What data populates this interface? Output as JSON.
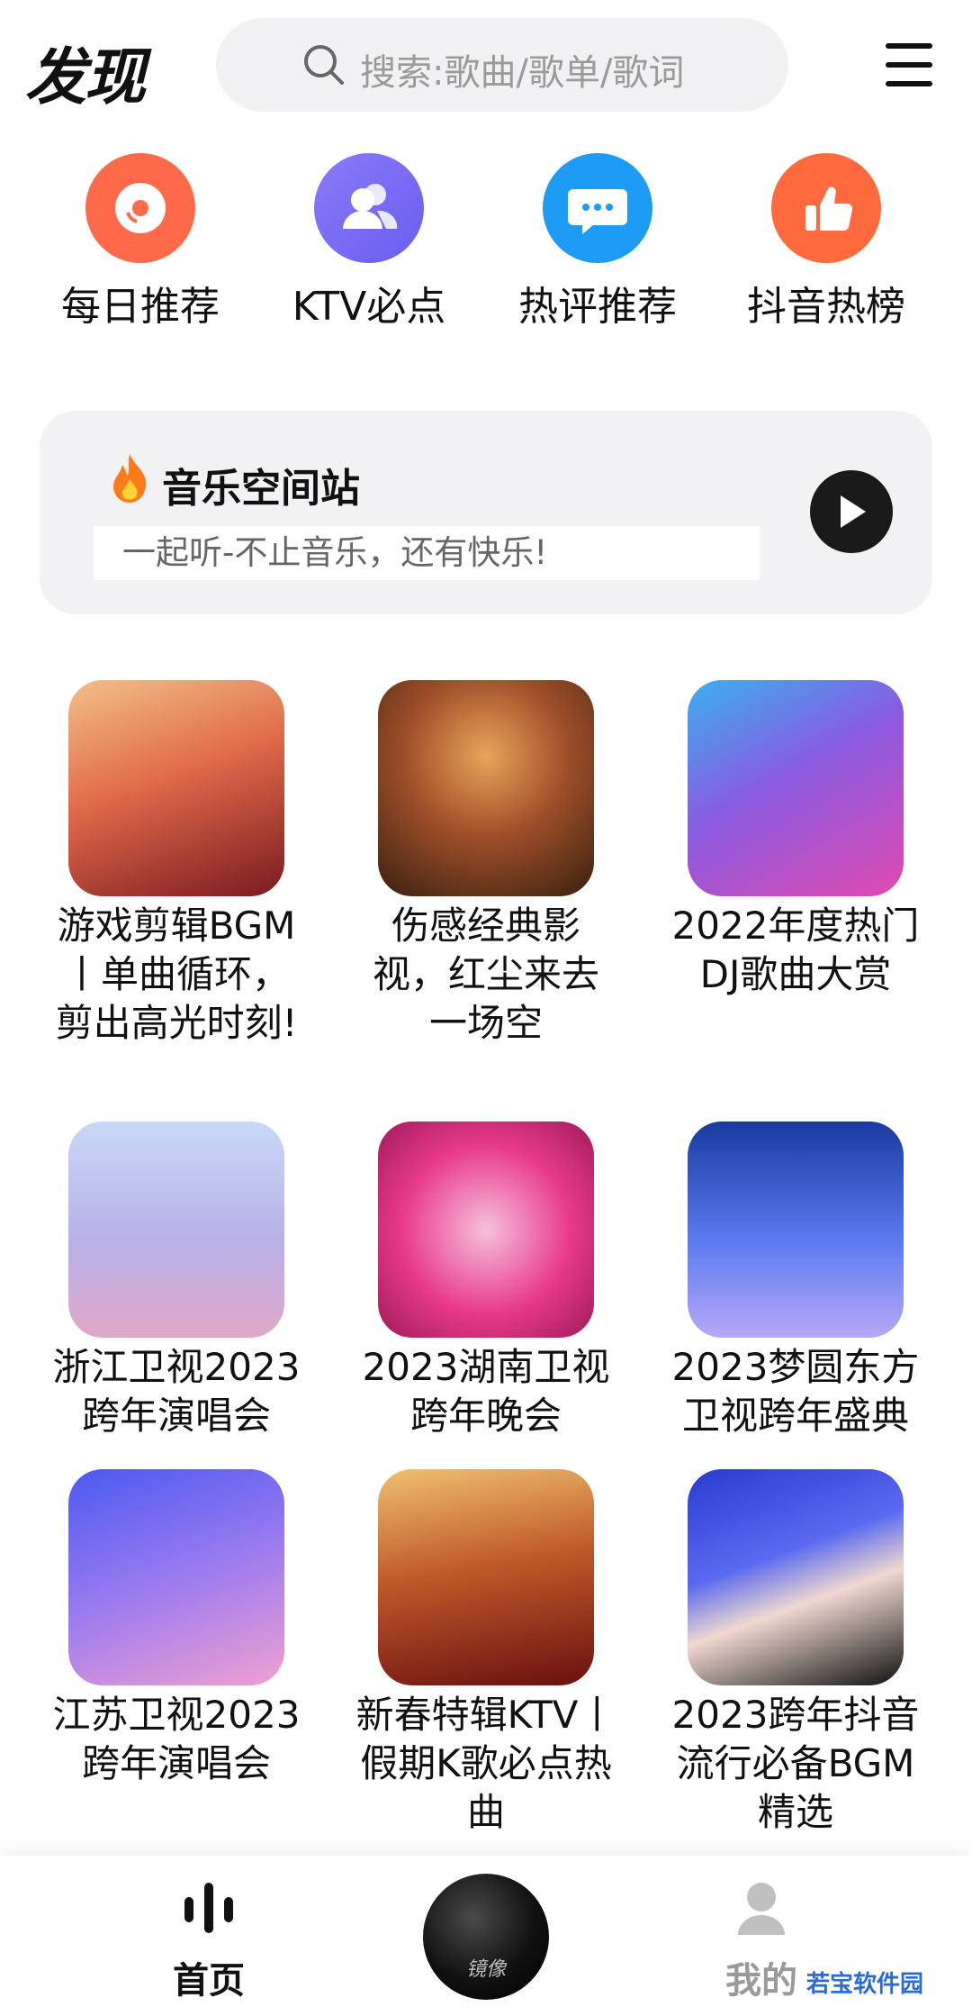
{
  "header": {
    "title": "发现",
    "search_placeholder": "搜索:歌曲/歌单/歌词"
  },
  "quick_entries": [
    {
      "label": "每日推荐",
      "icon": "vinyl-disc-icon",
      "color": "#ff6b4a"
    },
    {
      "label": "KTV必点",
      "icon": "users-icon",
      "color": "#7b6cf6"
    },
    {
      "label": "热评推荐",
      "icon": "chat-bubble-icon",
      "color": "#1e9bf5"
    },
    {
      "label": "抖音热榜",
      "icon": "thumbs-up-icon",
      "color": "#ff6a3d"
    }
  ],
  "banner": {
    "title": "音乐空间站",
    "subtitle": "一起听-不止音乐，还有快乐!"
  },
  "playlists": [
    {
      "title": "游戏剪辑BGM丨单曲循环，剪出高光时刻!",
      "colors": [
        "#f0a070",
        "#c0302a"
      ]
    },
    {
      "title": "伤感经典影视，红尘来去一场空",
      "colors": [
        "#d0702a",
        "#4a2a18"
      ]
    },
    {
      "title": "2022年度热门DJ歌曲大赏",
      "colors": [
        "#8a5ae0",
        "#e04ab0"
      ]
    },
    {
      "title": "浙江卫视2023跨年演唱会",
      "colors": [
        "#b8c8f0",
        "#e0a0c0"
      ]
    },
    {
      "title": "2023湖南卫视跨年晚会",
      "colors": [
        "#e83a8a",
        "#f6b0d0"
      ]
    },
    {
      "title": "2023梦圆东方卫视跨年盛典",
      "colors": [
        "#2a5ad0",
        "#9a8af0"
      ]
    },
    {
      "title": "江苏卫视2023跨年演唱会",
      "colors": [
        "#5a6af0",
        "#f0a0d0"
      ]
    },
    {
      "title": "新春特辑KTV丨假期K歌必点热曲",
      "colors": [
        "#e0a04a",
        "#8a1a1a"
      ]
    },
    {
      "title": "2023跨年抖音流行必备BGM精选",
      "colors": [
        "#3a4ad0",
        "#101010"
      ]
    }
  ],
  "tabbar": {
    "home_label": "首页",
    "mine_label": "我的",
    "disc_text": "镜像"
  },
  "watermark": "若宝软件园"
}
